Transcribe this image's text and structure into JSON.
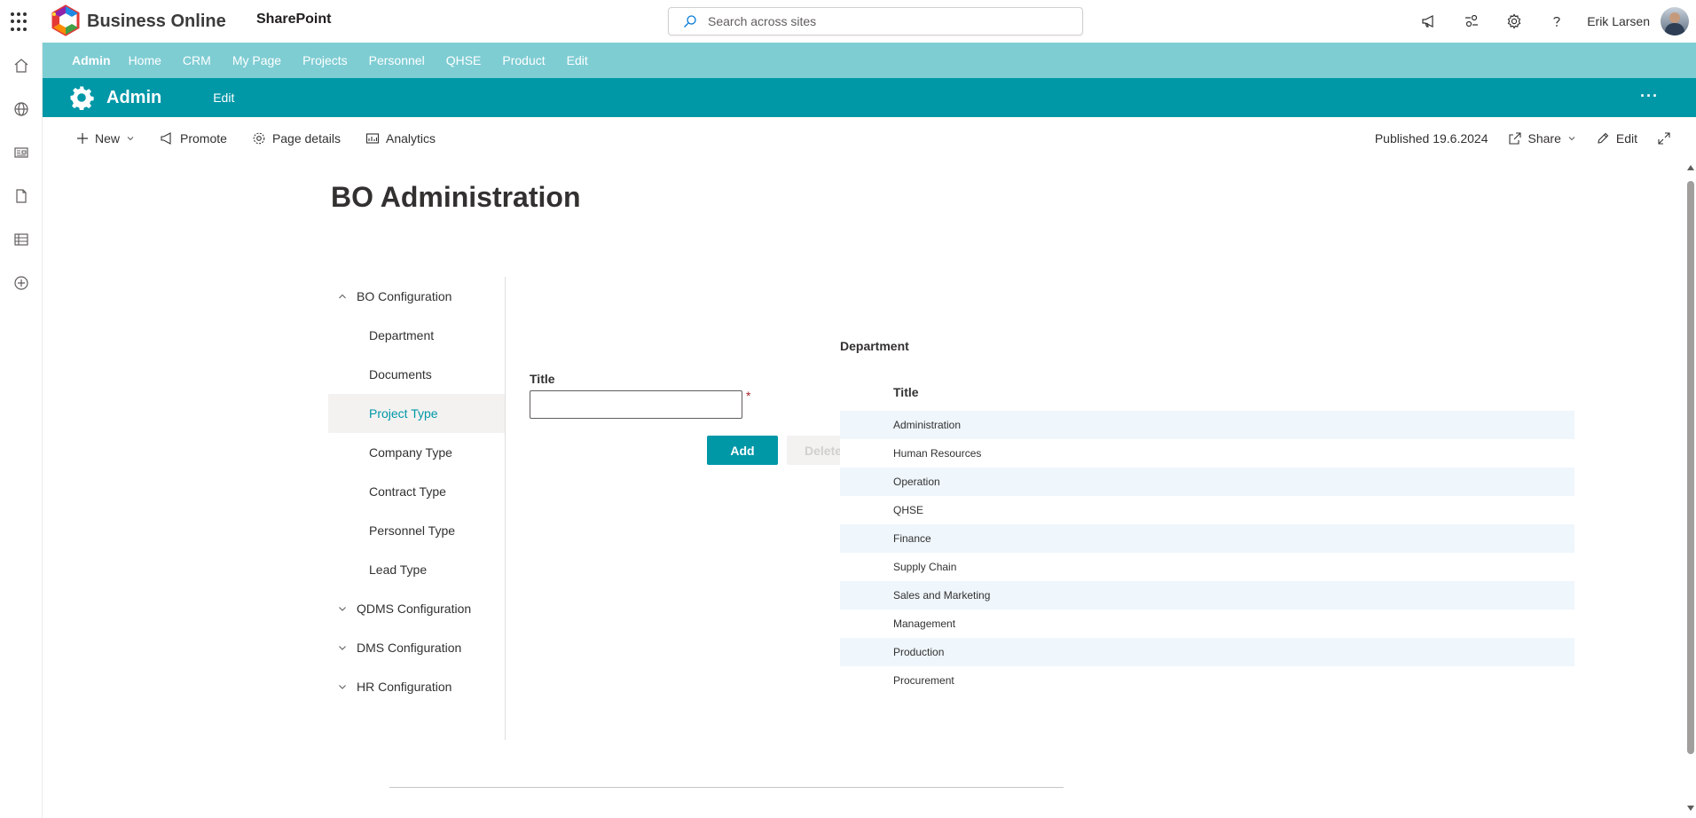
{
  "suite": {
    "brand": "Business Online",
    "app": "SharePoint",
    "search_placeholder": "Search across sites",
    "user_name": "Erik Larsen"
  },
  "hubnav": {
    "site": "Admin",
    "links": [
      "Home",
      "CRM",
      "My Page",
      "Projects",
      "Personnel",
      "QHSE",
      "Product",
      "Edit"
    ]
  },
  "site_header": {
    "title": "Admin",
    "edit": "Edit",
    "more": "···"
  },
  "command_bar": {
    "new": "New",
    "promote": "Promote",
    "page_details": "Page details",
    "analytics": "Analytics",
    "published": "Published 19.6.2024",
    "share": "Share",
    "edit": "Edit"
  },
  "page": {
    "title": "BO Administration"
  },
  "sidenav": {
    "groups": [
      {
        "label": "BO Configuration",
        "expanded": true,
        "children": [
          "Department",
          "Documents",
          "Project Type",
          "Company Type",
          "Contract Type",
          "Personnel Type",
          "Lead Type"
        ],
        "active_child": "Project Type"
      },
      {
        "label": "QDMS Configuration",
        "expanded": false
      },
      {
        "label": "DMS Configuration",
        "expanded": false
      },
      {
        "label": "HR Configuration",
        "expanded": false
      }
    ]
  },
  "form": {
    "title_label": "Title",
    "title_value": "",
    "required_mark": "*",
    "add_button": "Add",
    "delete_button": "Delete"
  },
  "list": {
    "heading": "Department",
    "column": "Title",
    "rows": [
      "Administration",
      "Human Resources",
      "Operation",
      "QHSE",
      "Finance",
      "Supply Chain",
      "Sales and Marketing",
      "Management",
      "Production",
      "Procurement"
    ]
  },
  "colors": {
    "hub_bar": "#7ecdd3",
    "site_header": "#0097a7",
    "accent": "#0097a7",
    "row_alt": "#eff6fc"
  }
}
